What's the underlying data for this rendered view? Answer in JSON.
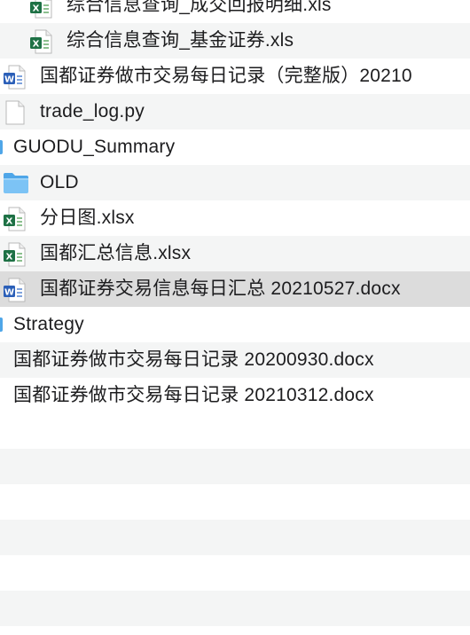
{
  "finder_list": {
    "rows": [
      {
        "name": "综合信息查询_成交回报明细.xls",
        "kind": "excel"
      },
      {
        "name": "综合信息查询_基金证券.xls",
        "kind": "excel"
      },
      {
        "name": "国都证券做市交易每日记录（完整版）20210",
        "kind": "word"
      },
      {
        "name": "trade_log.py",
        "kind": "text"
      },
      {
        "name": "GUODU_Summary",
        "kind": "folder"
      },
      {
        "name": "OLD",
        "kind": "folder"
      },
      {
        "name": "分日图.xlsx",
        "kind": "excel"
      },
      {
        "name": "国都汇总信息.xlsx",
        "kind": "excel"
      },
      {
        "name": "国都证券交易信息每日汇总 20210527.docx",
        "kind": "word",
        "selected": true
      },
      {
        "name": "Strategy",
        "kind": "folder"
      },
      {
        "name": "国都证券做市交易每日记录 20200930.docx",
        "kind": "word"
      },
      {
        "name": "国都证券做市交易每日记录 20210312.docx",
        "kind": "word"
      }
    ]
  },
  "colors": {
    "row_alternate": "#f4f5f5",
    "row_selected": "#dcdcdc",
    "folder_blue": "#4fa6e8",
    "excel_green": "#1e7145",
    "word_blue": "#2b5fb8"
  }
}
